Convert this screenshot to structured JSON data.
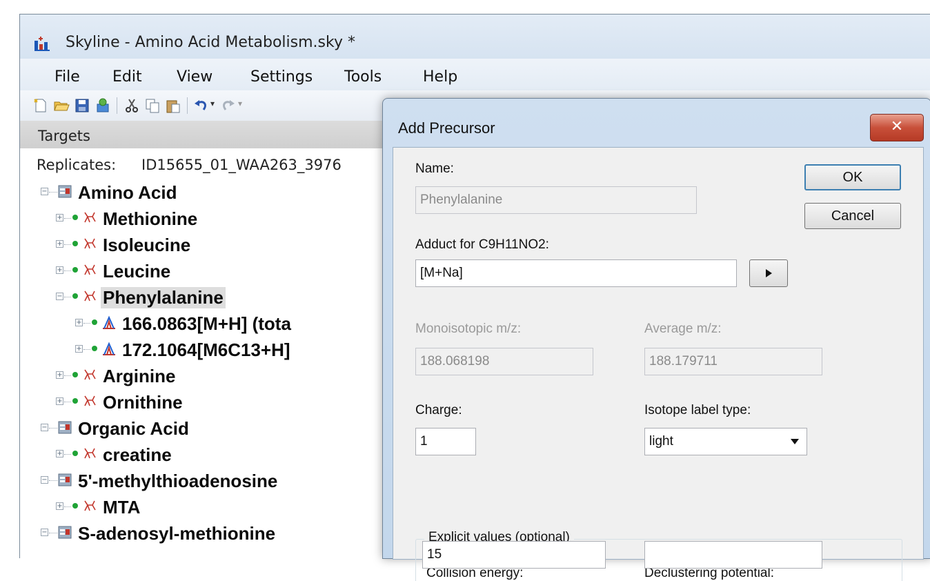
{
  "window": {
    "title": "Skyline - Amino Acid Metabolism.sky *"
  },
  "menu": {
    "items": [
      "File",
      "Edit",
      "View",
      "Settings",
      "Tools",
      "Help"
    ]
  },
  "targets": {
    "header": "Targets",
    "replicates_label": "Replicates:",
    "replicates_value": "ID15655_01_WAA263_3976",
    "tree": [
      {
        "label": "Amino Acid",
        "kind": "group",
        "level": 0,
        "expanded": true
      },
      {
        "label": "Methionine",
        "kind": "molecule",
        "level": 1,
        "expanded": false
      },
      {
        "label": "Isoleucine",
        "kind": "molecule",
        "level": 1,
        "expanded": false
      },
      {
        "label": "Leucine",
        "kind": "molecule",
        "level": 1,
        "expanded": false
      },
      {
        "label": "Phenylalanine",
        "kind": "molecule",
        "level": 1,
        "expanded": true,
        "selected": true
      },
      {
        "label": "166.0863[M+H] (tota",
        "kind": "precursor",
        "level": 2,
        "expanded": false
      },
      {
        "label": "172.1064[M6C13+H]",
        "kind": "precursor",
        "level": 2,
        "expanded": false
      },
      {
        "label": "Arginine",
        "kind": "molecule",
        "level": 1,
        "expanded": false
      },
      {
        "label": "Ornithine",
        "kind": "molecule",
        "level": 1,
        "expanded": false
      },
      {
        "label": "Organic Acid",
        "kind": "group",
        "level": 0,
        "expanded": true
      },
      {
        "label": "creatine",
        "kind": "molecule",
        "level": 1,
        "expanded": false
      },
      {
        "label": "5'-methylthioadenosine",
        "kind": "group",
        "level": 0,
        "expanded": true
      },
      {
        "label": "MTA",
        "kind": "molecule",
        "level": 1,
        "expanded": false
      },
      {
        "label": "S-adenosyl-methionine",
        "kind": "group",
        "level": 0,
        "expanded": true
      }
    ]
  },
  "dialog": {
    "title": "Add Precursor",
    "close_glyph": "✕",
    "name_label": "Name:",
    "name_value": "Phenylalanine",
    "ok_label": "OK",
    "cancel_label": "Cancel",
    "adduct_label": "Adduct for C9H11NO2:",
    "adduct_value": "[M+Na]",
    "mono_label": "Monoisotopic m/z:",
    "mono_value": "188.068198",
    "avg_label": "Average m/z:",
    "avg_value": "188.179711",
    "charge_label": "Charge:",
    "charge_value": "1",
    "isotope_label": "Isotope label type:",
    "isotope_value": "light",
    "explicit_legend": "Explicit values (optional)",
    "ce_label": "Collision energy:",
    "ce_value": "15",
    "dp_label": "Declustering potential:",
    "dp_value": ""
  },
  "colors": {
    "close_button": "#c8503a",
    "molecule_icon": "#c2352b",
    "precursor_icon_peak": "#1f5fd1",
    "status_dot": "#1fa336"
  },
  "icons": {
    "tree_group": "peptide-list-icon",
    "tree_molecule": "molecule-icon",
    "tree_precursor": "precursor-peak-icon"
  }
}
